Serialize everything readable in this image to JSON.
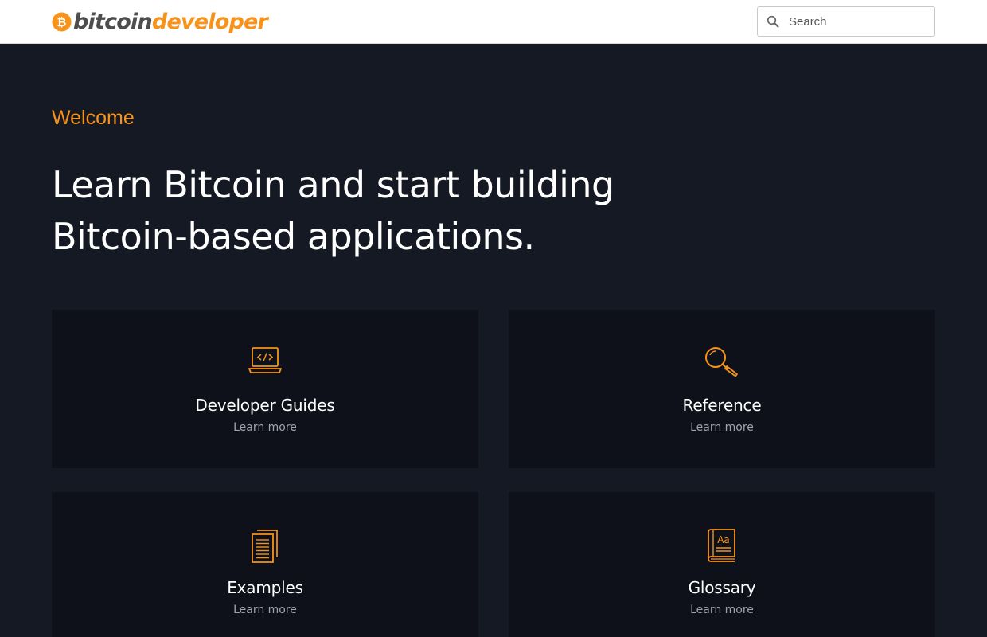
{
  "header": {
    "logo_bitcoin": "bitcoin",
    "logo_developer": "developer",
    "search_placeholder": "Search"
  },
  "hero": {
    "welcome": "Welcome",
    "headline": "Learn Bitcoin and start building Bitcoin-based applications."
  },
  "cards": [
    {
      "title": "Developer Guides",
      "link": "Learn more",
      "icon": "laptop-code-icon"
    },
    {
      "title": "Reference",
      "link": "Learn more",
      "icon": "magnifier-icon"
    },
    {
      "title": "Examples",
      "link": "Learn more",
      "icon": "documents-icon"
    },
    {
      "title": "Glossary",
      "link": "Learn more",
      "icon": "dictionary-book-icon"
    }
  ],
  "colors": {
    "accent": "#f7931a",
    "background": "#151923",
    "card": "#0e111a",
    "header": "#ffffff"
  }
}
